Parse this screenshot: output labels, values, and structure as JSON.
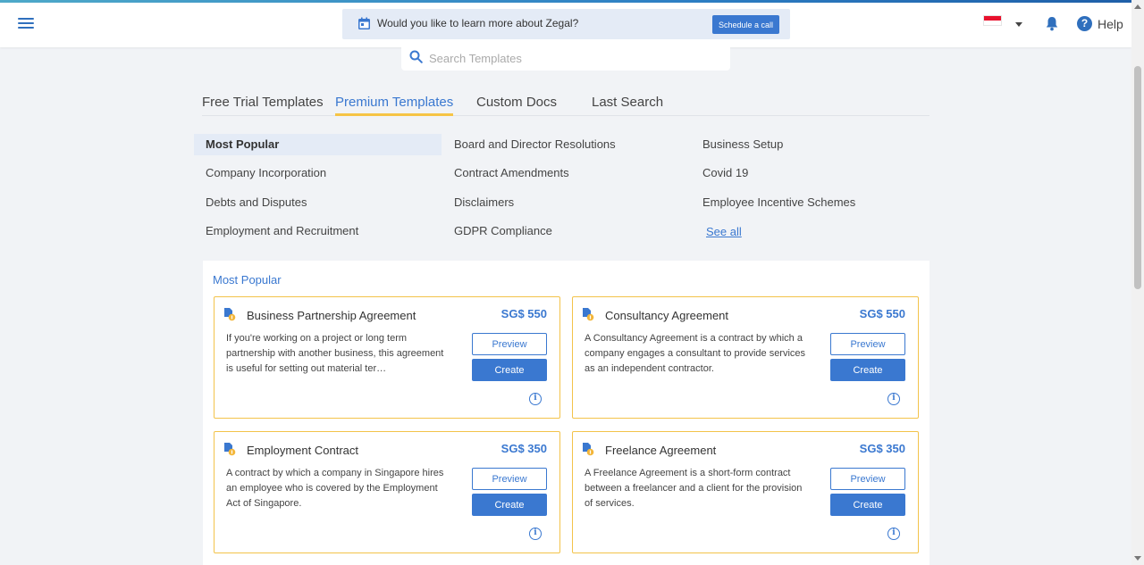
{
  "header": {
    "banner_text": "Would you like to learn more about Zegal?",
    "schedule_label": "Schedule a call",
    "help_label": "Help",
    "help_glyph": "?"
  },
  "search": {
    "placeholder": "Search Templates",
    "value": ""
  },
  "tabs": [
    {
      "label": "Free Trial Templates",
      "active": false
    },
    {
      "label": "Premium Templates",
      "active": true
    },
    {
      "label": "Custom Docs",
      "active": false
    },
    {
      "label": "Last Search",
      "active": false
    }
  ],
  "categories": [
    {
      "label": "Most Popular",
      "active": true
    },
    {
      "label": "Board and Director Resolutions"
    },
    {
      "label": "Business Setup"
    },
    {
      "label": "Company Incorporation"
    },
    {
      "label": "Contract Amendments"
    },
    {
      "label": "Covid 19"
    },
    {
      "label": "Debts and Disputes"
    },
    {
      "label": "Disclaimers"
    },
    {
      "label": "Employee Incentive Schemes"
    },
    {
      "label": "Employment and Recruitment"
    },
    {
      "label": "GDPR Compliance"
    },
    {
      "label": "See all",
      "link": true
    }
  ],
  "panel": {
    "title": "Most Popular",
    "preview_label": "Preview",
    "create_label": "Create",
    "info_glyph": "i",
    "cards": [
      {
        "title": "Business Partnership Agreement",
        "price": "SG$ 550",
        "description": "If you're working on a project or long term partnership with another business, this agreement is useful for setting out material ter…"
      },
      {
        "title": "Consultancy Agreement",
        "price": "SG$ 550",
        "description": "A Consultancy Agreement is a contract by which a company engages a consultant to provide services as an independent contractor."
      },
      {
        "title": "Employment Contract",
        "price": "SG$ 350",
        "description": "A contract by which a company in Singapore hires an employee who is covered by the Employment Act of Singapore."
      },
      {
        "title": "Freelance Agreement",
        "price": "SG$ 350",
        "description": "A Freelance Agreement is a short-form contract between a freelancer and a client for the provision of services."
      }
    ]
  },
  "colors": {
    "accent": "#3a78d0",
    "card_border": "#f3c34a",
    "tab_underline": "#f6c445",
    "banner_bg": "#e4ebf6"
  },
  "icons": {
    "menu": "hamburger-menu-icon",
    "calendar": "calendar-icon",
    "flag": "singapore-flag-icon",
    "bell": "bell-icon",
    "help": "help-circle-icon",
    "search": "search-icon",
    "document": "premium-document-icon",
    "info": "info-icon"
  }
}
